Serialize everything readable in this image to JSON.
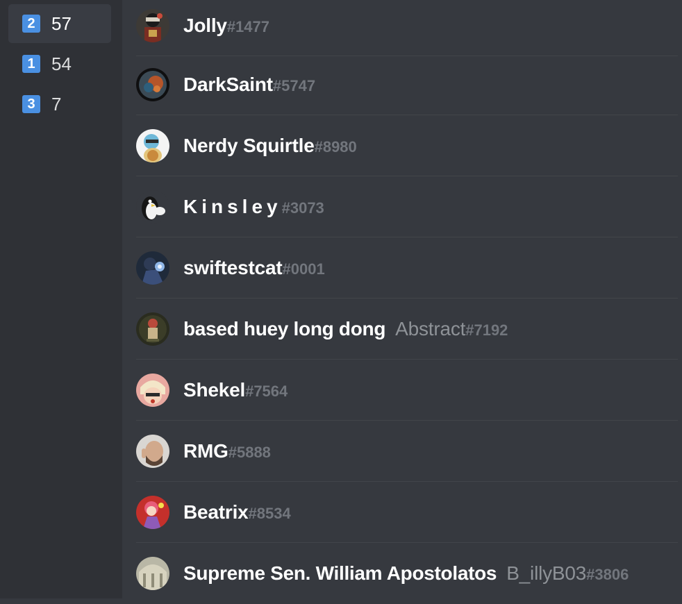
{
  "sidebar": {
    "tabs": [
      {
        "number": "2",
        "count": "57",
        "selected": true
      },
      {
        "number": "1",
        "count": "54",
        "selected": false
      },
      {
        "number": "3",
        "count": "7",
        "selected": false
      }
    ]
  },
  "members": [
    {
      "username": "Jolly",
      "discriminator": "#1477",
      "avatar": "jolly-avatar"
    },
    {
      "username": "DarkSaint",
      "discriminator": "#5747",
      "avatar": "darksaint-avatar"
    },
    {
      "username": "Nerdy Squirtle",
      "discriminator": "#8980",
      "avatar": "squirtle-avatar"
    },
    {
      "username": "Kinsley",
      "discriminator": "#3073",
      "avatar": "penguin-avatar"
    },
    {
      "username": "swiftestcat",
      "discriminator": "#0001",
      "avatar": "swiftestcat-avatar"
    },
    {
      "nickname": "based huey long dong",
      "username": "Abstract",
      "discriminator": "#7192",
      "avatar": "abstract-avatar"
    },
    {
      "username": "Shekel",
      "discriminator": "#7564",
      "avatar": "shekel-avatar"
    },
    {
      "username": "RMG",
      "discriminator": "#5888",
      "avatar": "rmg-avatar"
    },
    {
      "username": "Beatrix",
      "discriminator": "#8534",
      "avatar": "beatrix-avatar"
    },
    {
      "nickname": "Supreme Sen. William Apostolatos",
      "username": "B_illyB03",
      "discriminator": "#3806",
      "avatar": "billy-avatar"
    }
  ],
  "colors": {
    "background": "#36393f",
    "sidebar": "#2f3136",
    "badge": "#4a90e2",
    "discriminator": "#72767d"
  }
}
